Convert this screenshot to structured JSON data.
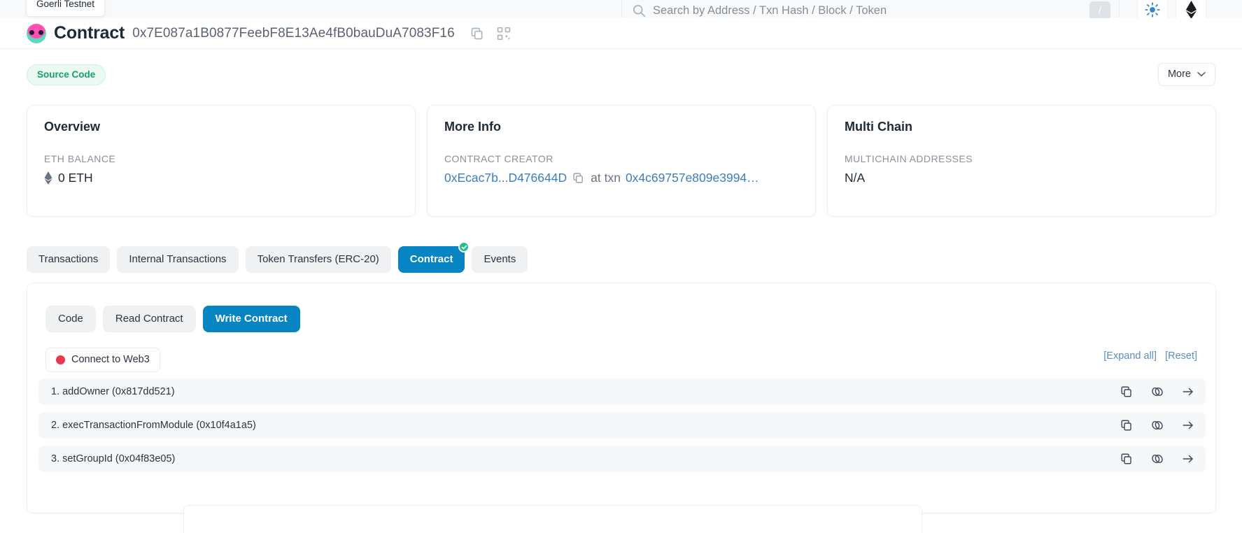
{
  "header": {
    "network_chip": "Goerli Testnet",
    "search": {
      "placeholder": "Search by Address / Txn Hash / Block / Token",
      "shortcut_key": "/"
    },
    "theme_toggle": "sun-icon",
    "chain_logo": "ethereum-icon"
  },
  "contract": {
    "title": "Contract",
    "address": "0x7E087a1B0877FeebF8E13Ae4fB0bauDuA7083F16",
    "copy_icon": "copy-icon",
    "qr_icon": "qr-code-icon"
  },
  "badge_row": {
    "source_code_badge": "Source Code",
    "more_button": "More"
  },
  "cards": {
    "overview": {
      "title": "Overview",
      "balance_label": "ETH BALANCE",
      "balance_value": "0 ETH"
    },
    "more_info": {
      "title": "More Info",
      "creator_label": "CONTRACT CREATOR",
      "creator_address": "0xEcac7b...D476644D",
      "at_txn_label": "at txn",
      "creation_txn": "0x4c69757e809e3994…"
    },
    "multi_chain": {
      "title": "Multi Chain",
      "addresses_label": "MULTICHAIN ADDRESSES",
      "addresses_value": "N/A"
    }
  },
  "tabs": [
    {
      "label": "Transactions",
      "active": false
    },
    {
      "label": "Internal Transactions",
      "active": false
    },
    {
      "label": "Token Transfers (ERC-20)",
      "active": false
    },
    {
      "label": "Contract",
      "active": true,
      "verified": true
    },
    {
      "label": "Events",
      "active": false
    }
  ],
  "contract_panel": {
    "subtabs": [
      {
        "label": "Code",
        "active": false
      },
      {
        "label": "Read Contract",
        "active": false
      },
      {
        "label": "Write Contract",
        "active": true
      }
    ],
    "connect_button": "Connect to Web3",
    "connect_status_color": "#e8364f",
    "expand_all": "[Expand all]",
    "reset": "[Reset]",
    "functions": [
      {
        "label": "1. addOwner (0x817dd521)"
      },
      {
        "label": "2. execTransactionFromModule (0x10f4a1a5)"
      },
      {
        "label": "3. setGroupId (0x04f83e05)"
      }
    ],
    "row_icons": [
      "copy-icon",
      "link-icon",
      "arrow-right-icon"
    ]
  },
  "colors": {
    "accent_blue": "#0784c3",
    "link_blue": "#3b7ebd",
    "verified_green": "#1ec28b",
    "badge_green": "#18a06a"
  }
}
